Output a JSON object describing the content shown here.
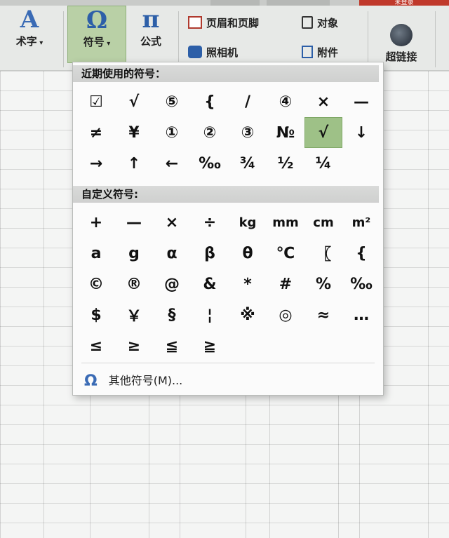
{
  "ribbon": {
    "art_text_label": "术字",
    "symbol_label": "符号",
    "formula_label": "公式",
    "header_footer_label": "页眉和页脚",
    "object_label": "对象",
    "camera_label": "照相机",
    "attachment_label": "附件",
    "hyperlink_label": "超链接",
    "login_label": "未登录"
  },
  "popup": {
    "recent_title": "近期使用的符号：",
    "custom_title": "自定义符号:",
    "recent_symbols": [
      "☑",
      "√",
      "⑤",
      "{",
      "/",
      "④",
      "×",
      "—",
      "≠",
      "¥",
      "①",
      "②",
      "③",
      "№",
      "√",
      "↓",
      "→",
      "↑",
      "←",
      "‰",
      "¾",
      "½",
      "¼"
    ],
    "custom_symbols": [
      "+",
      "—",
      "×",
      "÷",
      "kg",
      "mm",
      "cm",
      "m²",
      "a",
      "g",
      "α",
      "β",
      "θ",
      "℃",
      "〖",
      "{",
      "©",
      "®",
      "@",
      "&",
      "*",
      "#",
      "%",
      "‰",
      "$",
      "￥",
      "§",
      "¦",
      "※",
      "◎",
      "≈",
      "…",
      "≤",
      "≥",
      "≦",
      "≧"
    ],
    "more_symbols_label": "其他符号(M)...",
    "highlighted_index": 14
  },
  "icons": {
    "omega": "Ω",
    "pi": "π",
    "art_a": "A"
  },
  "colors": {
    "highlight": "#9ec187",
    "accent_blue": "#3a6bb5",
    "login_red": "#c0392b"
  }
}
